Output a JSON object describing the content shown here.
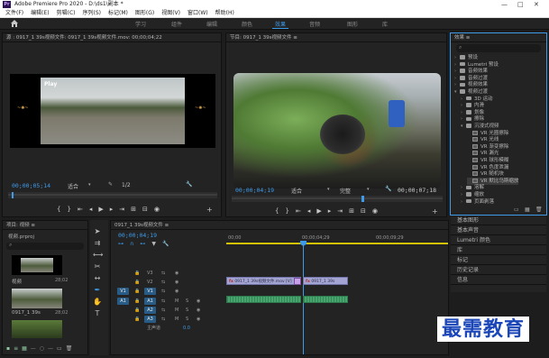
{
  "window": {
    "title": "Adobe Premiere Pro 2020 - D:\\ds1\\副本 *",
    "logo_text": "Pr"
  },
  "menu": [
    "文件(F)",
    "编辑(E)",
    "剪辑(C)",
    "序列(S)",
    "标记(M)",
    "图形(G)",
    "视图(V)",
    "窗口(W)",
    "帮助(H)"
  ],
  "workspace_tabs": [
    {
      "label": "学习",
      "active": false
    },
    {
      "label": "组件",
      "active": false
    },
    {
      "label": "编辑",
      "active": false
    },
    {
      "label": "颜色",
      "active": false
    },
    {
      "label": "效果",
      "active": true
    },
    {
      "label": "音频",
      "active": false
    },
    {
      "label": "图形",
      "active": false
    },
    {
      "label": "库",
      "active": false
    }
  ],
  "source": {
    "title": "源 : 0917_1 39s视频文件: 0917_1 39s视频文件.mov: 00;00;04;22",
    "overlay_text": "Play",
    "timecode": "00;00;05;14",
    "fit": "适合",
    "resolution": "1/2"
  },
  "program": {
    "title": "节目: 0917_1 39s视频文件 ≡",
    "timecode_current": "00;00;04;19",
    "fit": "适合",
    "resolution": "完整",
    "timecode_duration": "00;00;07;18"
  },
  "effects": {
    "title": "效果 ≡",
    "items": [
      {
        "label": "预设",
        "kind": "folder",
        "depth": 0
      },
      {
        "label": "Lumetri 预设",
        "kind": "folder",
        "depth": 0
      },
      {
        "label": "音频效果",
        "kind": "folder",
        "depth": 0
      },
      {
        "label": "音频过渡",
        "kind": "folder",
        "depth": 0
      },
      {
        "label": "视频效果",
        "kind": "folder",
        "depth": 0
      },
      {
        "label": "视频过渡",
        "kind": "folder",
        "depth": 0
      },
      {
        "label": "3D 运动",
        "kind": "folder",
        "depth": 1
      },
      {
        "label": "内滑",
        "kind": "folder",
        "depth": 1
      },
      {
        "label": "划像",
        "kind": "folder",
        "depth": 1
      },
      {
        "label": "擦除",
        "kind": "folder",
        "depth": 1
      },
      {
        "label": "沉浸式视频",
        "kind": "folder",
        "depth": 1
      },
      {
        "label": "VR 光圈擦除",
        "kind": "fx",
        "depth": 2
      },
      {
        "label": "VR 光线",
        "kind": "fx",
        "depth": 2
      },
      {
        "label": "VR 渐变擦除",
        "kind": "fx",
        "depth": 2
      },
      {
        "label": "VR 漏光",
        "kind": "fx",
        "depth": 2
      },
      {
        "label": "VR 球形模糊",
        "kind": "fx",
        "depth": 2
      },
      {
        "label": "VR 色度泄漏",
        "kind": "fx",
        "depth": 2
      },
      {
        "label": "VR 随机块",
        "kind": "fx",
        "depth": 2
      },
      {
        "label": "VR 默比乌斯缩放",
        "kind": "fx",
        "depth": 2
      },
      {
        "label": "溶解",
        "kind": "folder",
        "depth": 1
      },
      {
        "label": "缩放",
        "kind": "folder",
        "depth": 1
      },
      {
        "label": "页面剥落",
        "kind": "folder",
        "depth": 1
      }
    ]
  },
  "side_panels": [
    "基本图形",
    "基本声音",
    "Lumetri 颜色",
    "库",
    "标记",
    "历史记录",
    "信息"
  ],
  "project": {
    "title": "项目: 视频 ≡",
    "file": "视频.prproj",
    "bins": [
      {
        "name": "视频",
        "duration": "28;02"
      },
      {
        "name": "0917_1 39s",
        "duration": "28;02"
      }
    ]
  },
  "timeline": {
    "title": "0917_1 39s视频文件 ≡",
    "timecode": "00;00;04;19",
    "ruler": [
      "00;00",
      "00;00;04;29",
      "00;00;09;29"
    ],
    "tracks_video": [
      "V3",
      "V2",
      "V1"
    ],
    "tracks_audio": [
      "A1",
      "A2",
      "A3"
    ],
    "master": "主声道",
    "master_value": "0.0",
    "src_patch_v": "V1",
    "src_patch_a": "A1",
    "clip_v1_a": "0917_1 39s视频文件.mov [V]",
    "clip_v1_b": "0917_1 39s",
    "fx_mark": "fx"
  },
  "watermark": "最需教育"
}
